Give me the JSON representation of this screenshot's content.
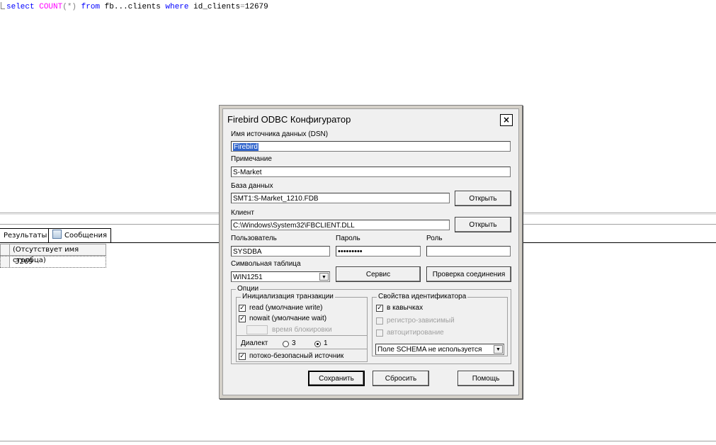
{
  "sql": {
    "select": "select",
    "func": "COUNT",
    "open": "(*)",
    "from": "from",
    "table": "fb...clients",
    "where": "where",
    "column": "id_clients",
    "eq": "=",
    "value": "12679"
  },
  "results": {
    "tabs": [
      {
        "label": "Результаты"
      },
      {
        "label": "Сообщения"
      }
    ],
    "column_header": "(Отсутствует имя столбца)",
    "rows": [
      {
        "value": "3269"
      }
    ]
  },
  "dialog": {
    "title": "Firebird ODBC Конфигуратор",
    "close": "×",
    "dsn_label": "Имя источника данных (DSN)",
    "dsn_value": "Firebird",
    "note_label": "Примечание",
    "note_value": "S-Market",
    "db_label": "База данных",
    "db_value": "SMT1:S-Market_1210.FDB",
    "open_label": "Открыть",
    "client_label": "Клиент",
    "client_value": "C:\\Windows\\System32\\FBCLIENT.DLL",
    "user_label": "Пользователь",
    "user_value": "SYSDBA",
    "password_label": "Пароль",
    "password_value": "•••••••••",
    "role_label": "Роль",
    "role_value": "",
    "charset_label": "Символьная таблица",
    "charset_value": "WIN1251",
    "service_label": "Сервис",
    "test_label": "Проверка соединения",
    "options_title": "Опции",
    "tx_title": "Инициализация транзакции",
    "read_label": "read (умолчание write)",
    "nowait_label": "nowait (умолчание wait)",
    "lock_label": "время блокировки",
    "dialect_label": "Диалект",
    "dialect_3": "3",
    "dialect_1": "1",
    "threadsafe_label": "потоко-безопасный источник",
    "ident_title": "Свойства идентификатора",
    "quoted_label": "в кавычках",
    "case_label": "регистро-зависимый",
    "autoquote_label": "автоцитирование",
    "schema_value": "Поле SCHEMA не используется",
    "save_label": "Сохранить",
    "reset_label": "Сбросить",
    "help_label": "Помощь"
  }
}
